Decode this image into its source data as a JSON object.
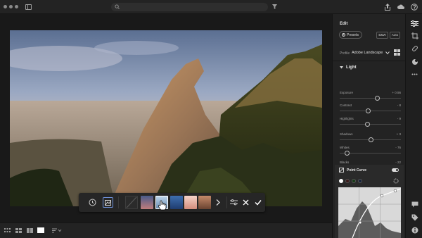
{
  "search": {
    "placeholder": ""
  },
  "panel": {
    "title": "Edit",
    "presets_label": "Presets",
    "bw_label": "B&W",
    "auto_label": "Auto",
    "profile_label": "Profile",
    "profile_value": "Adobe Landscape",
    "section": "Light",
    "sliders": [
      {
        "label": "Exposure",
        "value": "+ 0.56",
        "position": 0.61
      },
      {
        "label": "Contrast",
        "value": "- 8",
        "position": 0.46
      },
      {
        "label": "Highlights",
        "value": "- 9",
        "position": 0.455
      },
      {
        "label": "Shadows",
        "value": "+ 3",
        "position": 0.515
      },
      {
        "label": "Whites",
        "value": "- 76",
        "position": 0.12
      },
      {
        "label": "Blacks",
        "value": "- 22",
        "position": 0.39
      }
    ],
    "curve_title": "Point Curve",
    "curve_channels": [
      "#ffffff",
      "#3a1a1a",
      "#173a17",
      "#17233a"
    ]
  },
  "icons": {
    "window_dots": "window-control-icons",
    "top_right": [
      "share-icon",
      "cloud-icon",
      "help-icon"
    ],
    "rail_top": [
      "edit-sliders-icon",
      "crop-icon",
      "healing-brush-icon",
      "masking-icon",
      "more-icon"
    ],
    "rail_bottom": [
      "comment-icon",
      "tag-icon",
      "info-icon"
    ],
    "bottom_views": [
      "grid-small-view-icon",
      "grid-large-view-icon",
      "compare-view-icon",
      "detail-view-icon",
      "sort-icon"
    ]
  },
  "filmstrip": {
    "thumbnails": [
      "#2b2b2b",
      "#4a5b8a",
      "#8fb7d8",
      "#3e6fb0",
      "#f0b8a8",
      "#b97a5c"
    ]
  }
}
